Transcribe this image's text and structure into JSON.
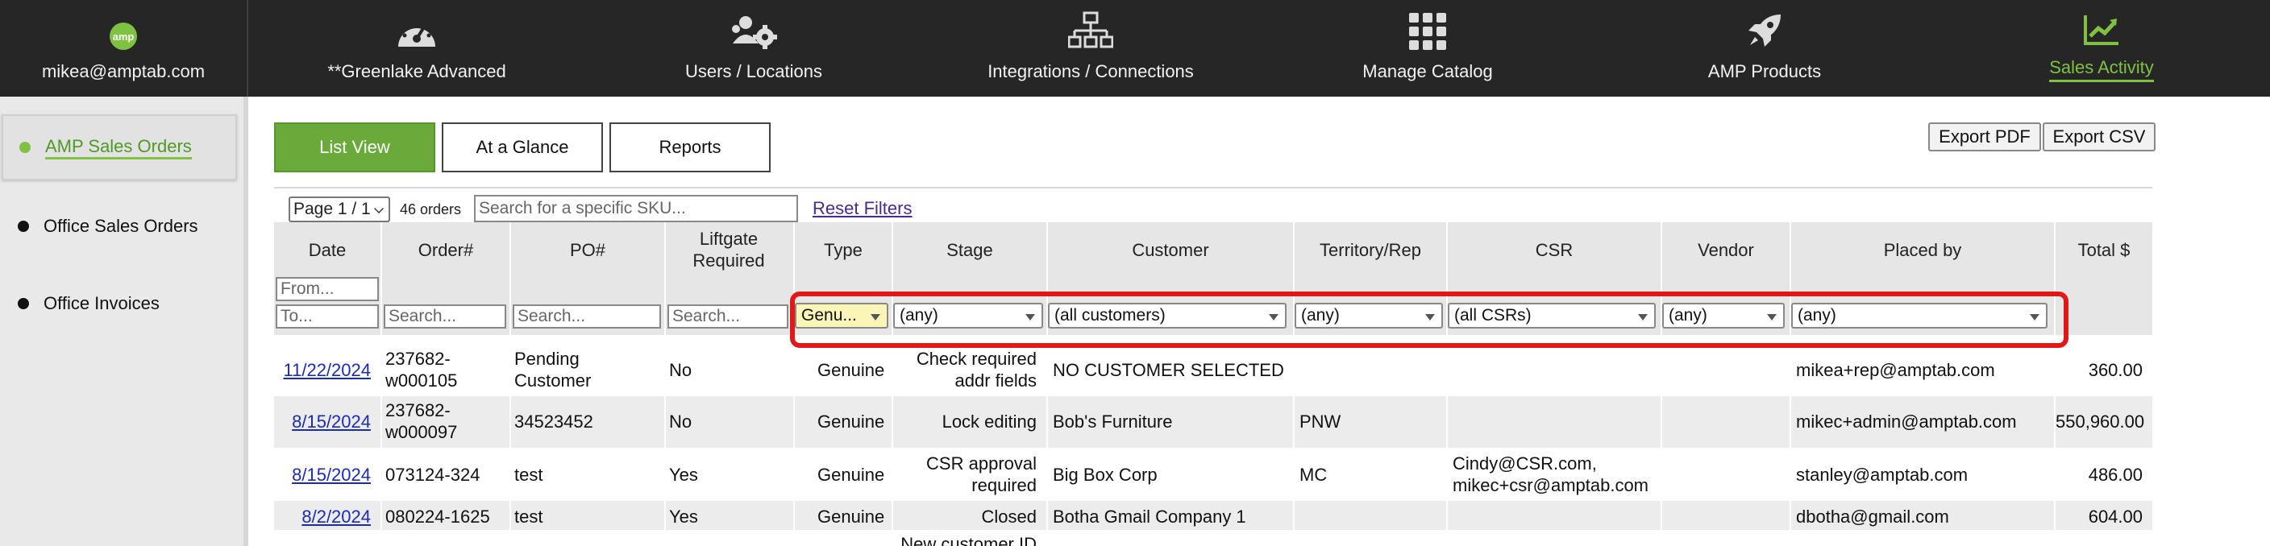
{
  "nav": {
    "user_email": "mikea@amptab.com",
    "items": [
      {
        "label": "**Greenlake Advanced",
        "icon": "dashboard-icon"
      },
      {
        "label": "Users / Locations",
        "icon": "users-gear-icon"
      },
      {
        "label": "Integrations / Connections",
        "icon": "network-icon"
      },
      {
        "label": "Manage Catalog",
        "icon": "grid-icon"
      },
      {
        "label": "AMP Products",
        "icon": "rocket-icon"
      },
      {
        "label": "Sales Activity",
        "icon": "trend-chart-icon",
        "active": true
      }
    ]
  },
  "sidebar": {
    "items": [
      {
        "label": "AMP Sales Orders",
        "active": true
      },
      {
        "label": "Office Sales Orders"
      },
      {
        "label": "Office Invoices"
      }
    ]
  },
  "views": {
    "list": "List View",
    "glance": "At a Glance",
    "reports": "Reports"
  },
  "export": {
    "pdf": "Export PDF",
    "csv": "Export CSV"
  },
  "toolbar": {
    "pager": "Page 1 / 1",
    "count": "46 orders",
    "sku_placeholder": "Search for a specific SKU...",
    "reset": "Reset Filters"
  },
  "columns": {
    "date": "Date",
    "order": "Order#",
    "po": "PO#",
    "liftgate": "Liftgate Required",
    "type": "Type",
    "stage": "Stage",
    "customer": "Customer",
    "territory": "Territory/Rep",
    "csr": "CSR",
    "vendor": "Vendor",
    "placed_by": "Placed by",
    "total": "Total $"
  },
  "filters": {
    "date_from": "From...",
    "date_to": "To...",
    "order": "Search...",
    "po": "Search...",
    "liftgate": "Search...",
    "type": "Genu...",
    "stage": "(any)",
    "customer": "(all customers)",
    "territory": "(any)",
    "csr": "(all CSRs)",
    "vendor": "(any)",
    "placed_by": "(any)"
  },
  "rows": [
    {
      "date": "11/22/2024",
      "order": "237682-\nw000105",
      "po": "Pending\nCustomer",
      "liftgate": "No",
      "type": "Genuine",
      "stage": "Check required\naddr fields",
      "customer": "NO CUSTOMER SELECTED",
      "territory": "",
      "csr": "",
      "vendor": "",
      "placed_by": "mikea+rep@amptab.com",
      "total": "360.00"
    },
    {
      "date": "8/15/2024",
      "order": "237682-\nw000097",
      "po": "34523452",
      "liftgate": "No",
      "type": "Genuine",
      "stage": "Lock editing",
      "customer": "Bob's Furniture",
      "territory": "PNW",
      "csr": "",
      "vendor": "",
      "placed_by": "mikec+admin@amptab.com",
      "total": "550,960.00"
    },
    {
      "date": "8/15/2024",
      "order": "073124-324",
      "po": "test",
      "liftgate": "Yes",
      "type": "Genuine",
      "stage": "CSR approval\nrequired",
      "customer": "Big Box Corp",
      "territory": "MC",
      "csr": "Cindy@CSR.com,\nmikec+csr@amptab.com",
      "vendor": "",
      "placed_by": "stanley@amptab.com",
      "total": "486.00"
    },
    {
      "date": "8/2/2024",
      "order": "080224-1625",
      "po": "test",
      "liftgate": "Yes",
      "type": "Genuine",
      "stage": "Closed",
      "customer": "Botha Gmail Company 1",
      "territory": "",
      "csr": "",
      "vendor": "",
      "placed_by": "dbotha@gmail.com",
      "total": "604.00"
    },
    {
      "date": "",
      "order": "",
      "po": "",
      "liftgate": "",
      "type": "",
      "stage": "New customer ID",
      "customer": "",
      "territory": "",
      "csr": "",
      "vendor": "",
      "placed_by": "",
      "total": ""
    }
  ]
}
